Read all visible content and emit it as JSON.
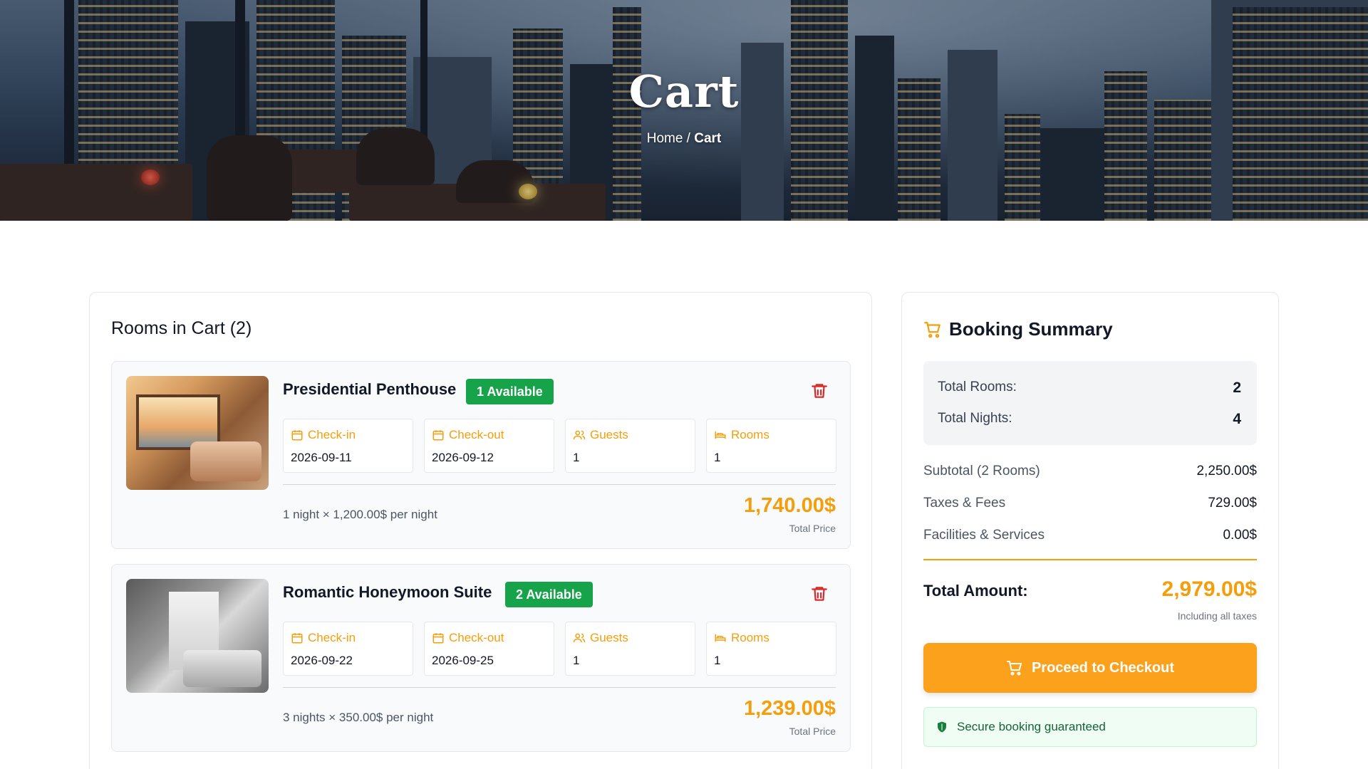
{
  "hero": {
    "title": "Cart",
    "breadcrumb_home": "Home",
    "breadcrumb_sep": " / ",
    "breadcrumb_current": "Cart"
  },
  "cart": {
    "title": "Rooms in Cart (2)",
    "items": [
      {
        "name": "Presidential Penthouse",
        "availability": "1 Available",
        "checkin_label": "Check-in",
        "checkin": "2026-09-11",
        "checkout_label": "Check-out",
        "checkout": "2026-09-12",
        "guests_label": "Guests",
        "guests": "1",
        "rooms_label": "Rooms",
        "rooms": "1",
        "nights_info": "1 night × 1,200.00$ per night",
        "total_price": "1,740.00$",
        "total_label": "Total Price"
      },
      {
        "name": "Romantic Honeymoon Suite",
        "availability": "2 Available",
        "checkin_label": "Check-in",
        "checkin": "2026-09-22",
        "checkout_label": "Check-out",
        "checkout": "2026-09-25",
        "guests_label": "Guests",
        "guests": "1",
        "rooms_label": "Rooms",
        "rooms": "1",
        "nights_info": "3 nights × 350.00$ per night",
        "total_price": "1,239.00$",
        "total_label": "Total Price"
      }
    ]
  },
  "summary": {
    "title": "Booking Summary",
    "total_rooms_label": "Total Rooms:",
    "total_rooms": "2",
    "total_nights_label": "Total Nights:",
    "total_nights": "4",
    "subtotal_label": "Subtotal (2 Rooms)",
    "subtotal": "2,250.00$",
    "taxes_label": "Taxes & Fees",
    "taxes": "729.00$",
    "facilities_label": "Facilities & Services",
    "facilities": "0.00$",
    "total_amount_label": "Total Amount:",
    "total_amount": "2,979.00$",
    "total_note": "Including all taxes",
    "checkout_button": "Proceed to Checkout",
    "secure_text": "Secure booking guaranteed"
  },
  "colors": {
    "accent": "#f59e0b",
    "button": "#fba11b",
    "available_badge": "#16a34a",
    "delete_icon": "#dc2626",
    "secure_bg": "#f0fdf4"
  },
  "icons": [
    "shopping-cart-icon",
    "calendar-icon",
    "users-icon",
    "bed-icon",
    "trash-icon",
    "shield-icon"
  ]
}
